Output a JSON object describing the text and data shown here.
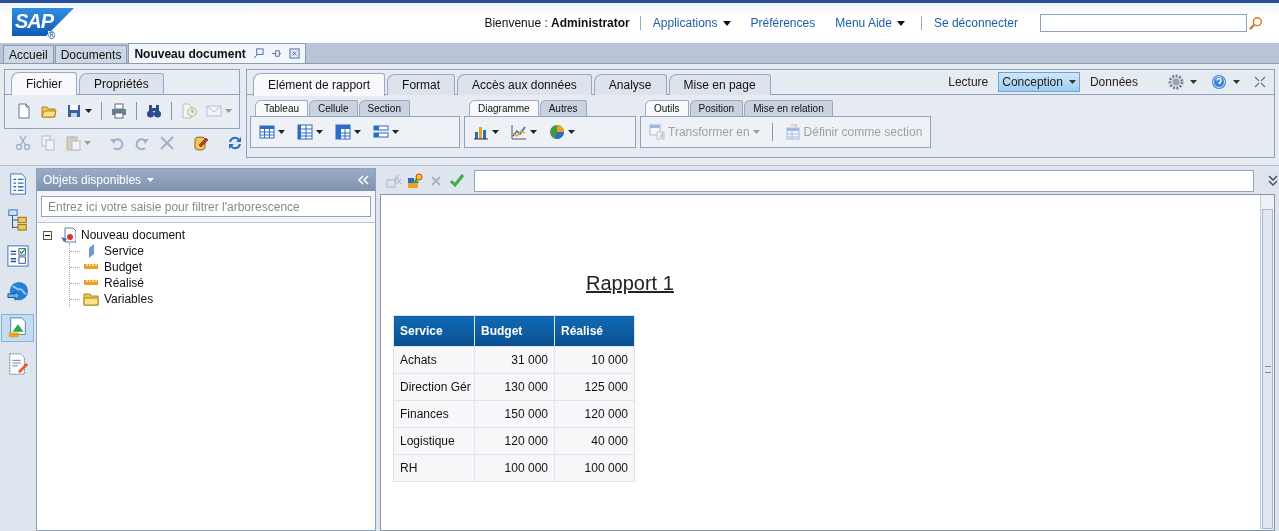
{
  "header": {
    "logo": {
      "text": "SAP",
      "mark": "®"
    },
    "welcome": "Bienvenue : **Administrator**",
    "links": [
      {
        "label": "Applications",
        "menu": true
      },
      {
        "label": "Préférences",
        "menu": false
      },
      {
        "label": "Menu Aide",
        "menu": true
      },
      {
        "label": "Se déconnecter",
        "menu": false
      }
    ]
  },
  "doc_tabs": [
    {
      "label": "Accueil",
      "selected": false
    },
    {
      "label": "Documents",
      "selected": false
    },
    {
      "label": "Nouveau document",
      "selected": true
    }
  ],
  "file_ribbon": {
    "tabs": [
      {
        "label": "Fichier",
        "selected": true
      },
      {
        "label": "Propriétés",
        "selected": false
      }
    ],
    "rows": [
      [
        [
          {
            "kind": "new",
            "disabled": false,
            "menu": false
          },
          {
            "kind": "open",
            "disabled": false,
            "menu": false
          },
          {
            "kind": "save",
            "disabled": false,
            "menu": true
          }
        ],
        [
          {
            "kind": "print",
            "disabled": false,
            "menu": false
          }
        ],
        [
          {
            "kind": "find",
            "disabled": false,
            "menu": false
          }
        ],
        [
          {
            "kind": "schedule",
            "disabled": true,
            "menu": false
          },
          {
            "kind": "mail",
            "disabled": true,
            "menu": true
          }
        ]
      ],
      [
        [
          {
            "kind": "cut",
            "disabled": true,
            "menu": false
          },
          {
            "kind": "copy",
            "disabled": true,
            "menu": false
          },
          {
            "kind": "paste",
            "disabled": true,
            "menu": true
          }
        ],
        [
          {
            "kind": "undo",
            "disabled": true,
            "menu": false
          },
          {
            "kind": "redo",
            "disabled": true,
            "menu": false
          },
          {
            "kind": "delete",
            "disabled": true,
            "menu": false
          }
        ],
        [
          {
            "kind": "edit",
            "disabled": false,
            "menu": false
          }
        ],
        [
          {
            "kind": "refresh",
            "disabled": false,
            "menu": false
          }
        ]
      ]
    ]
  },
  "ribbon": {
    "tabs": [
      {
        "label": "Elément de rapport",
        "selected": true
      },
      {
        "label": "Format",
        "selected": false
      },
      {
        "label": "Accès aux données",
        "selected": false
      },
      {
        "label": "Analyse",
        "selected": false
      },
      {
        "label": "Mise en page",
        "selected": false
      }
    ],
    "view_modes": [
      {
        "label": "Lecture",
        "selected": false,
        "menu": false
      },
      {
        "label": "Conception",
        "selected": true,
        "menu": true
      },
      {
        "label": "Données",
        "selected": false,
        "menu": false
      }
    ],
    "groups": [
      {
        "tabs": [
          {
            "label": "Tableau",
            "selected": true
          },
          {
            "label": "Cellule",
            "selected": false
          },
          {
            "label": "Section",
            "selected": false
          }
        ],
        "tools": [
          {
            "kind": "grid",
            "disabled": false,
            "menu": true
          },
          {
            "kind": "columns",
            "disabled": false,
            "menu": true
          },
          {
            "kind": "crosstab",
            "disabled": false,
            "menu": true
          },
          {
            "kind": "form",
            "disabled": false,
            "menu": true
          }
        ]
      },
      {
        "tabs": [
          {
            "label": "Diagramme",
            "selected": true
          },
          {
            "label": "Autres",
            "selected": false
          }
        ],
        "tools": [
          {
            "kind": "bar",
            "disabled": false,
            "menu": true
          },
          {
            "kind": "line",
            "disabled": false,
            "menu": true
          },
          {
            "kind": "pie",
            "disabled": false,
            "menu": true
          }
        ]
      },
      {
        "tabs": [
          {
            "label": "Outils",
            "selected": true
          },
          {
            "label": "Position",
            "selected": false
          },
          {
            "label": "Mise en relation",
            "selected": false
          }
        ],
        "tools": [
          {
            "kind": "transform",
            "label": "Transformer en",
            "disabled": true,
            "menu": true
          },
          {
            "kind": "section",
            "label": "Définir comme section",
            "disabled": true,
            "menu": false
          }
        ]
      }
    ]
  },
  "side_rail": [
    {
      "kind": "doclist",
      "selected": false
    },
    {
      "kind": "tree",
      "selected": false
    },
    {
      "kind": "checklist",
      "selected": false
    },
    {
      "kind": "globe",
      "selected": false
    },
    {
      "kind": "chartdoc",
      "selected": true
    },
    {
      "kind": "docedit",
      "selected": false
    }
  ],
  "panel": {
    "title": "Objets disponibles",
    "filter_placeholder": "Entrez ici votre saisie pour filtrer l'arborescence",
    "tree": [
      {
        "label": "Nouveau document",
        "kind": "document",
        "expanded": true,
        "children": [
          {
            "label": "Service",
            "kind": "dimension"
          },
          {
            "label": "Budget",
            "kind": "measure"
          },
          {
            "label": "Réalisé",
            "kind": "measure"
          },
          {
            "label": "Variables",
            "kind": "folder"
          }
        ]
      }
    ]
  },
  "formula_bar": {
    "tools": [
      {
        "kind": "fx",
        "disabled": true
      },
      {
        "kind": "variable",
        "disabled": false
      },
      {
        "kind": "cancel",
        "disabled": true
      },
      {
        "kind": "validate",
        "disabled": false
      }
    ]
  },
  "report": {
    "title": "Rapport 1",
    "table": {
      "columns": [
        "Service",
        "Budget",
        "Réalisé"
      ],
      "rows": [
        [
          "Achats",
          "31 000",
          "10 000"
        ],
        [
          "Direction Gér",
          "130 000",
          "125 000"
        ],
        [
          "Finances",
          "150 000",
          "120 000"
        ],
        [
          "Logistique",
          "120 000",
          "40 000"
        ],
        [
          "RH",
          "100 000",
          "100 000"
        ]
      ]
    }
  }
}
